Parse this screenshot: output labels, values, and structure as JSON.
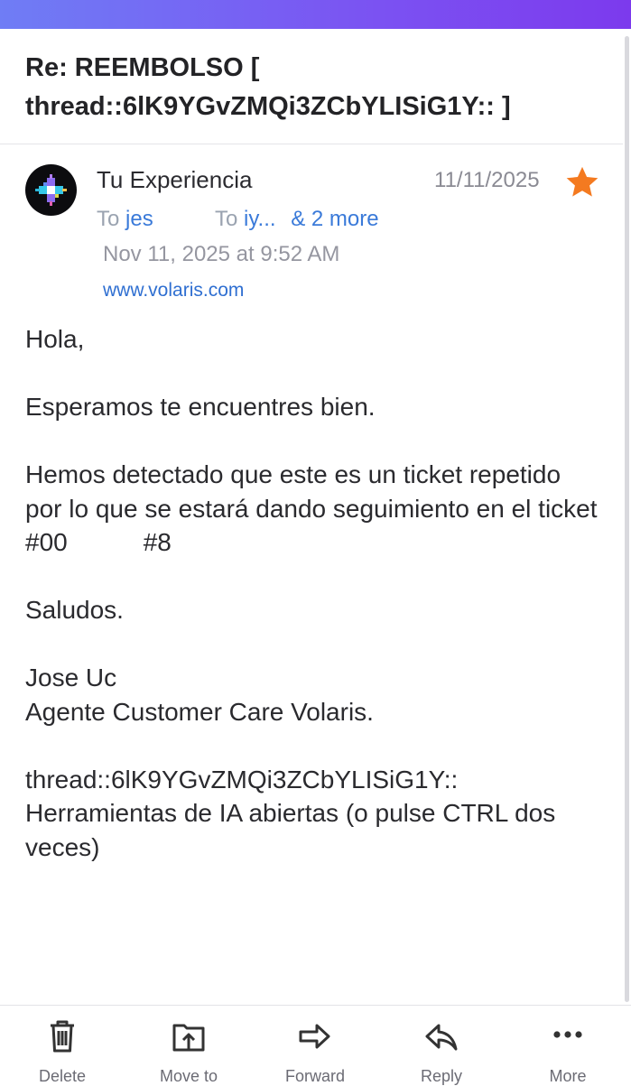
{
  "email": {
    "subject": "Re: REEMBOLSO [ thread::6lK9YGvZMQi3ZCbYLISiG1Y:: ]",
    "sender": "Tu Experiencia",
    "date_short": "11/11/2025",
    "starred": true,
    "to_label_1": "To",
    "recipient_1": "jes",
    "to_label_2": "To",
    "recipient_2": "iy...",
    "more_recipients": "& 2 more",
    "date_full": "Nov 11, 2025 at 9:52 AM",
    "website": "www.volaris.com",
    "body": {
      "greeting": "Hola,",
      "line1": "Esperamos te encuentres bien.",
      "line2_a": "Hemos detectado que este es un ticket repetido por lo que se estará dando seguimiento en el ticket #00",
      "line2_b": "8",
      "closing": "Saludos.",
      "signature_name": "Jose Uc",
      "signature_title": "Agente Customer Care Volaris.",
      "thread_id": "thread::6lK9YGvZMQi3ZCbYLISiG1Y::",
      "ai_tools": "Herramientas de IA abiertas (o pulse CTRL dos veces)"
    }
  },
  "toolbar": {
    "delete": "Delete",
    "move_to": "Move to",
    "forward": "Forward",
    "reply": "Reply",
    "more": "More"
  },
  "colors": {
    "star": "#f47a20",
    "link": "#3a7ad9",
    "header_gradient_start": "#6f7df5",
    "header_gradient_end": "#7c3aed"
  }
}
